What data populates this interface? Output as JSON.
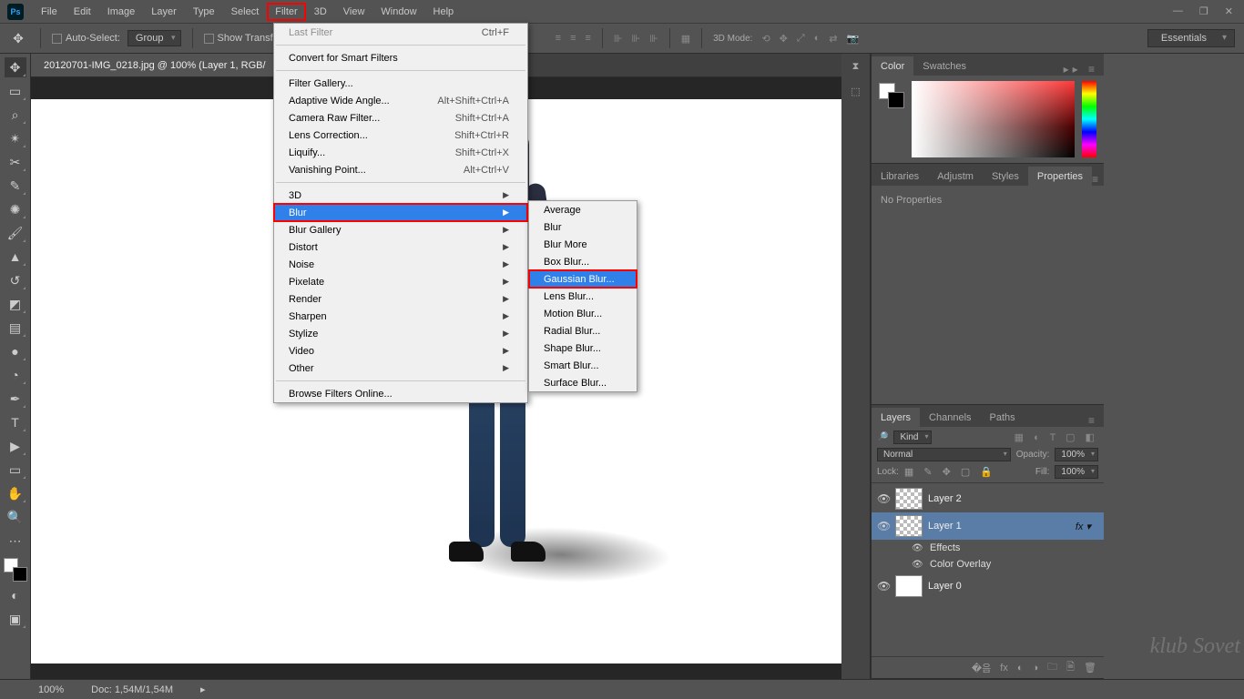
{
  "menus": [
    "File",
    "Edit",
    "Image",
    "Layer",
    "Type",
    "Select",
    "Filter",
    "3D",
    "View",
    "Window",
    "Help"
  ],
  "highlighted_menu_index": 6,
  "options": {
    "auto_select": "Auto-Select:",
    "group": "Group",
    "show_transform": "Show Transf",
    "mode_label": "3D Mode:",
    "workspace": "Essentials"
  },
  "doc_tab": "20120701-IMG_0218.jpg @ 100% (Layer 1, RGB/",
  "filter_menu": {
    "last": {
      "label": "Last Filter",
      "shortcut": "Ctrl+F",
      "disabled": true
    },
    "top": [
      {
        "label": "Convert for Smart Filters"
      }
    ],
    "mid": [
      {
        "label": "Filter Gallery..."
      },
      {
        "label": "Adaptive Wide Angle...",
        "shortcut": "Alt+Shift+Ctrl+A"
      },
      {
        "label": "Camera Raw Filter...",
        "shortcut": "Shift+Ctrl+A"
      },
      {
        "label": "Lens Correction...",
        "shortcut": "Shift+Ctrl+R"
      },
      {
        "label": "Liquify...",
        "shortcut": "Shift+Ctrl+X"
      },
      {
        "label": "Vanishing Point...",
        "shortcut": "Alt+Ctrl+V"
      }
    ],
    "subs": [
      {
        "label": "3D"
      },
      {
        "label": "Blur",
        "hl": true,
        "box": true
      },
      {
        "label": "Blur Gallery"
      },
      {
        "label": "Distort"
      },
      {
        "label": "Noise"
      },
      {
        "label": "Pixelate"
      },
      {
        "label": "Render"
      },
      {
        "label": "Sharpen"
      },
      {
        "label": "Stylize"
      },
      {
        "label": "Video"
      },
      {
        "label": "Other"
      }
    ],
    "browse": "Browse Filters Online..."
  },
  "blur_submenu": [
    {
      "label": "Average"
    },
    {
      "label": "Blur"
    },
    {
      "label": "Blur More"
    },
    {
      "label": "Box Blur..."
    },
    {
      "label": "Gaussian Blur...",
      "hl": true,
      "box": true
    },
    {
      "label": "Lens Blur..."
    },
    {
      "label": "Motion Blur..."
    },
    {
      "label": "Radial Blur..."
    },
    {
      "label": "Shape Blur..."
    },
    {
      "label": "Smart Blur..."
    },
    {
      "label": "Surface Blur..."
    }
  ],
  "panels": {
    "color_tab": "Color",
    "swatches_tab": "Swatches",
    "tabs2": [
      "Libraries",
      "Adjustm",
      "Styles",
      "Properties"
    ],
    "noprops": "No Properties",
    "layers_tabs": [
      "Layers",
      "Channels",
      "Paths"
    ],
    "kind": "Kind",
    "blend": "Normal",
    "opacity_label": "Opacity:",
    "opacity": "100%",
    "lock_label": "Lock:",
    "fill_label": "Fill:",
    "fill": "100%",
    "layers": [
      {
        "name": "Layer 2"
      },
      {
        "name": "Layer 1",
        "sel": true,
        "fx": true
      },
      {
        "name": "Layer 0",
        "white": true
      }
    ],
    "effects": "Effects",
    "overlay": "Color Overlay"
  },
  "status": {
    "zoom": "100%",
    "doc": "Doc: 1,54M/1,54M"
  },
  "watermark": "klub\nSovet"
}
